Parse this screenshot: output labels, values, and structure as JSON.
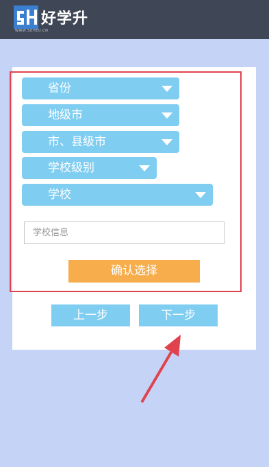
{
  "header": {
    "logo_icon": "hxs-logo-mark",
    "title": "好学升",
    "url": "WWW.SOHEU.CN"
  },
  "form": {
    "dropdowns": [
      {
        "label": "省份"
      },
      {
        "label": "地级市"
      },
      {
        "label": "市、县级市"
      },
      {
        "label": "学校级别"
      },
      {
        "label": "学校"
      }
    ],
    "school_info_placeholder": "学校信息",
    "school_info_value": "",
    "confirm_label": "确认选择"
  },
  "nav": {
    "prev_label": "上一步",
    "next_label": "下一步"
  },
  "colors": {
    "background": "#c5d3f6",
    "header": "#3f4655",
    "dropdown": "#7fcdf1",
    "confirm": "#f7ad4c",
    "highlight_box": "#e0424e",
    "arrow": "#e0424e"
  },
  "annotation": {
    "icon": "red-arrow-pointing-up-right"
  }
}
